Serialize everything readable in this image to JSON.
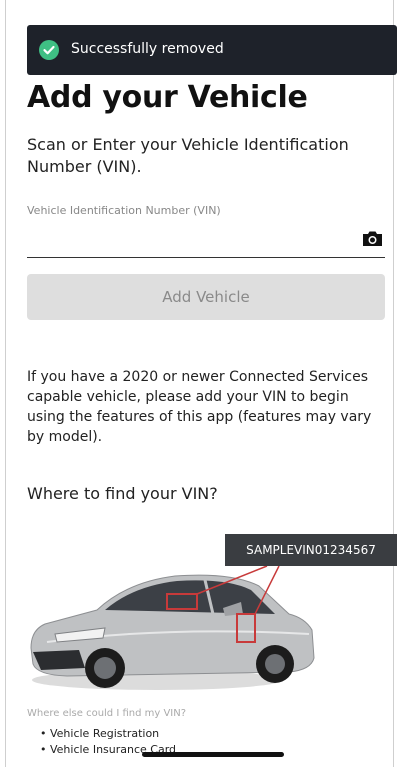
{
  "toast": {
    "message": "Successfully removed"
  },
  "page": {
    "title": "Add your Vehicle",
    "intro": "Scan or Enter your Vehicle Identification Number (VIN)."
  },
  "vin_field": {
    "placeholder": "Vehicle Identification Number (VIN)",
    "value": ""
  },
  "add_button": {
    "label": "Add Vehicle"
  },
  "info_text": "If you have a 2020 or newer Connected Services capable vehicle, please add your VIN to begin using the features of this app (features may vary by model).",
  "where": {
    "title": "Where to find your VIN?",
    "sample_vin": "SAMPLEVIN01234567",
    "else_title": "Where else could I find my VIN?",
    "locations": [
      "• Vehicle Registration",
      "• Vehicle Insurance Card"
    ]
  },
  "colors": {
    "toast_bg": "#1e222a",
    "success": "#3fbf84",
    "button_disabled": "#dedede",
    "highlight": "#c83a3a",
    "vin_tag_bg": "#3a3d41"
  },
  "icons": [
    "check-circle-icon",
    "camera-icon"
  ]
}
